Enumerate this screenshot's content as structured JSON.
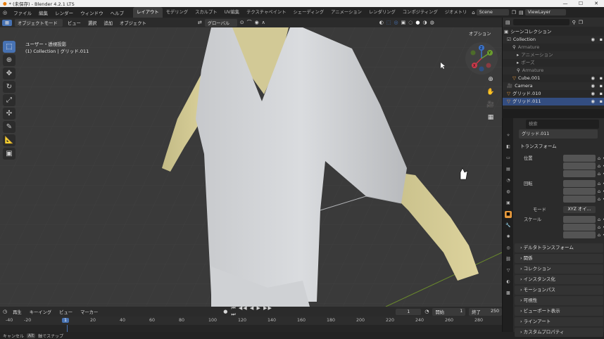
{
  "window": {
    "title": "* (未保存) - Blender 4.2.1 LTS"
  },
  "menu": [
    "ファイル",
    "編集",
    "レンダー",
    "ウィンドウ",
    "ヘルプ"
  ],
  "workspaces": [
    "レイアウト",
    "モデリング",
    "スカルプト",
    "UV編集",
    "テクスチャペイント",
    "シェーディング",
    "アニメーション",
    "レンダリング",
    "コンポジティング",
    "ジオメトリ"
  ],
  "active_workspace": "レイアウト",
  "scene": {
    "name": "Scene",
    "view_layer": "ViewLayer"
  },
  "viewport_header": {
    "mode": "オブジェクトモード",
    "items": [
      "ビュー",
      "選択",
      "追加",
      "オブジェクト"
    ],
    "orientation": "グローバル",
    "options": "オプション"
  },
  "viewport_info": {
    "line1": "ユーザー・透視投影",
    "line2": "(1) Collection | グリッド.011"
  },
  "gizmo_axes": {
    "z": "Z",
    "y": "Y",
    "x": "X"
  },
  "outliner": {
    "search_placeholder": "",
    "rows": [
      {
        "label": "シーンコレクション"
      },
      {
        "label": "Collection"
      },
      {
        "label": "Armature"
      },
      {
        "label": "アニメーション"
      },
      {
        "label": "ポーズ"
      },
      {
        "label": "Armature"
      },
      {
        "label": "Cube.001"
      },
      {
        "label": "Camera"
      },
      {
        "label": "グリッド.010"
      },
      {
        "label": "グリッド.011"
      }
    ]
  },
  "properties": {
    "search_placeholder": "検索",
    "object_name": "グリッド.011",
    "transform_title": "トランスフォーム",
    "location_label": "位置",
    "rotation_label": "回転",
    "scale_label": "スケール",
    "mode_label": "モード",
    "mode_value": "XYZ オイ...",
    "axes": [
      "X",
      "Y",
      "Z"
    ],
    "location": [
      "0.016226",
      "0.011751",
      "3.931 m"
    ],
    "rotation": [
      "-0.000009",
      "0°",
      "0°"
    ],
    "scale": [
      "1.000",
      "1.000",
      "1.000"
    ],
    "sections": [
      "デルタトランスフォーム",
      "関係",
      "コレクション",
      "インスタンス化",
      "モーションパス",
      "可視性",
      "ビューポート表示",
      "ラインアート",
      "カスタムプロパティ"
    ]
  },
  "timeline": {
    "items": [
      "再生",
      "キーイング",
      "ビュー",
      "マーカー"
    ],
    "current_frame": "1",
    "start_label": "開始",
    "start": "1",
    "end_label": "終了",
    "end": "250",
    "ruler": [
      "-40",
      "-20",
      "1",
      "20",
      "40",
      "60",
      "80",
      "100",
      "120",
      "140",
      "160",
      "180",
      "200",
      "220",
      "240",
      "260",
      "280"
    ]
  },
  "statusbar": {
    "left": "キャンセル",
    "hint": "Alt",
    "hint2": "軸でスナップ",
    "version": "4.2.1"
  },
  "colors": {
    "accent": "#4772b3",
    "shirt": "#d7d9dc",
    "skin": "#d6cd97",
    "grid": "#3b3b3b"
  }
}
